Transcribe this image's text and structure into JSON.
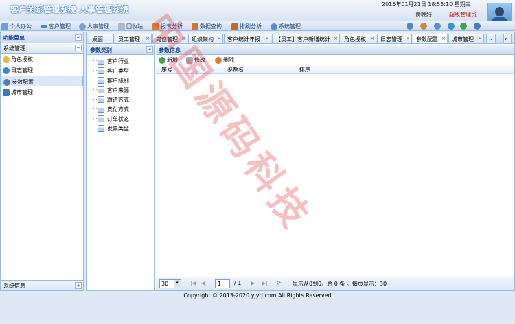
{
  "header": {
    "app_title": "客户关系管理系统 人事管理系统",
    "datetime": "2015年01月21日 18:55:10 星期三",
    "greeting": "傍晚好!",
    "role": "超级管理员"
  },
  "menu": {
    "items": [
      "个人办公",
      "客户管理",
      "人事管理",
      "回收站",
      "报表分析",
      "数据查询",
      "排刷分析",
      "系统管理"
    ]
  },
  "west": {
    "title": "功能菜单",
    "section": "系统管理",
    "items": [
      "角色授权",
      "日志管理",
      "参数配置",
      "城市管理"
    ],
    "bottom": "系统信息"
  },
  "tabs": [
    "桌面",
    "员工管理",
    "岗位管理",
    "组织架构",
    "客户统计年报",
    "【员工】客户新增统计",
    "角色授权",
    "日志管理",
    "参数配置",
    "城市管理"
  ],
  "types": {
    "title": "参数类别",
    "items": [
      "客户行业",
      "客户类型",
      "客户级别",
      "客户来源",
      "跟进方式",
      "支付方式",
      "订单状态",
      "发票类型"
    ]
  },
  "params": {
    "title": "参数信息",
    "add": "新增",
    "edit": "修改",
    "delete": "删除",
    "columns": [
      "序号",
      "参数名",
      "排序"
    ]
  },
  "pager": {
    "page_size": "30",
    "page": "1",
    "total_pages": "/ 1",
    "info": "显示从0到0，总 0 条 。每页显示：30"
  },
  "footer": "Copyright © 2013-2020 yjyrj.com All Rights Reserved",
  "watermark": "中国源码科技"
}
